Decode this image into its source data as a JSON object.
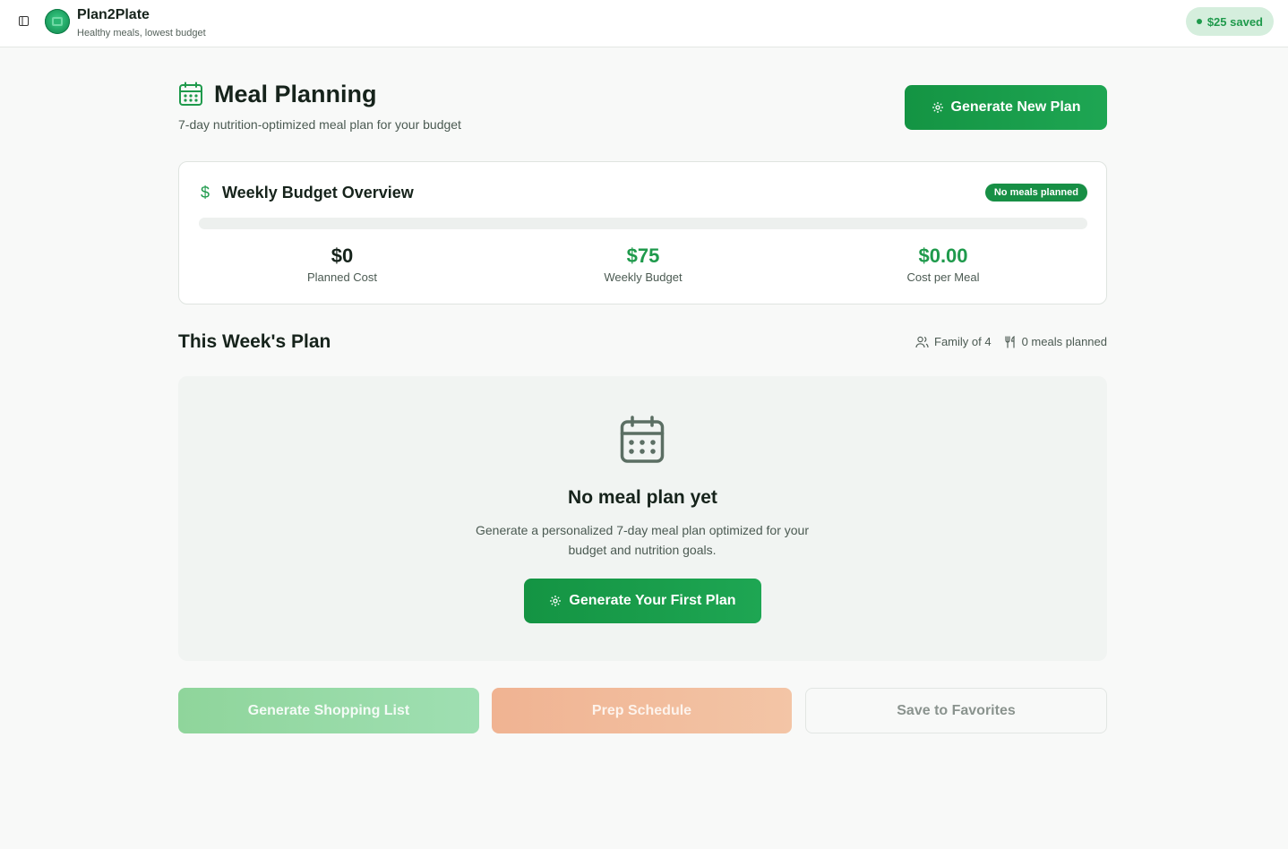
{
  "app": {
    "name": "Plan2Plate",
    "tagline": "Healthy meals, lowest budget",
    "saved_badge": "$25 saved"
  },
  "page": {
    "title": "Meal Planning",
    "subtitle": "7-day nutrition-optimized meal plan for your budget",
    "generate_button": "Generate New Plan",
    "icon": "calendar-icon"
  },
  "budget": {
    "title": "Weekly Budget Overview",
    "icon": "dollar-icon",
    "status": "No meals planned",
    "progress_fraction": 0,
    "stats": [
      {
        "value": "$0",
        "label": "Planned Cost",
        "color": "#16231b"
      },
      {
        "value": "$75",
        "label": "Weekly Budget",
        "color": "#1f9a4c"
      },
      {
        "value": "$0.00",
        "label": "Cost per Meal",
        "color": "#1f9a4c"
      }
    ]
  },
  "week": {
    "title": "This Week's Plan",
    "family": "Family of 4",
    "meals_planned": "0 meals planned"
  },
  "empty_state": {
    "title": "No meal plan yet",
    "description": "Generate a personalized 7-day meal plan optimized for your budget and nutrition goals.",
    "button": "Generate Your First Plan"
  },
  "actions": {
    "shopping_list": "Generate Shopping List",
    "prep_schedule": "Prep Schedule",
    "save_favorites": "Save to Favorites"
  },
  "colors": {
    "primary": "#1f9a4c",
    "accent_orange": "#f0b392"
  }
}
